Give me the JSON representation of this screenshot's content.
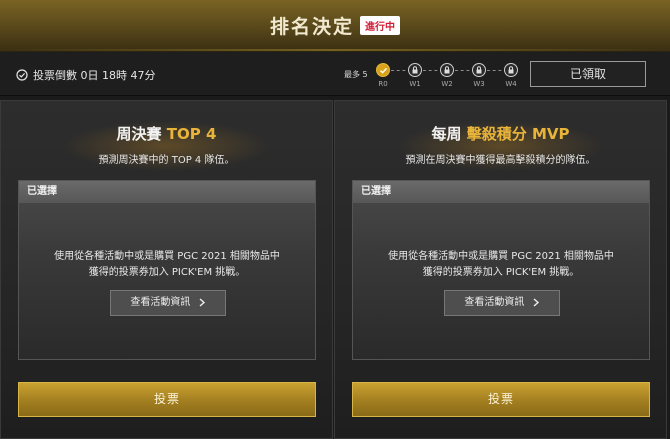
{
  "header": {
    "title": "排名決定",
    "status_badge": "進行中"
  },
  "topbar": {
    "countdown": "投票倒數 0日 18時 47分",
    "max_label": "最多 5",
    "steps": [
      {
        "label": "R0",
        "state": "done"
      },
      {
        "label": "W1",
        "state": "locked"
      },
      {
        "label": "W2",
        "state": "locked"
      },
      {
        "label": "W3",
        "state": "locked"
      },
      {
        "label": "W4",
        "state": "locked"
      }
    ],
    "claimed_button": "已領取"
  },
  "panels": [
    {
      "title_prefix": "周決賽",
      "title_highlight": "TOP 4",
      "description": "預測周決賽中的 TOP 4 隊伍。",
      "chosen_header": "已選擇",
      "body_line1": "使用從各種活動中或是購買 PGC 2021 相關物品中",
      "body_line2": "獲得的投票券加入 PICK'EM 挑戰。",
      "info_button": "查看活動資訊",
      "vote_button": "投票"
    },
    {
      "title_prefix": "每周",
      "title_highlight": "擊殺積分 MVP",
      "description": "預測在周決賽中獲得最高擊殺積分的隊伍。",
      "chosen_header": "已選擇",
      "body_line1": "使用從各種活動中或是購買 PGC 2021 相關物品中",
      "body_line2": "獲得的投票券加入 PICK'EM 挑戰。",
      "info_button": "查看活動資訊",
      "vote_button": "投票"
    }
  ],
  "colors": {
    "accent_gold": "#e9b43a",
    "badge_red": "#d21c35",
    "vote_gold": "#a58121"
  },
  "icons": {
    "countdown": "check-circle-icon",
    "step_done": "check-icon",
    "step_locked": "lock-icon",
    "info_arrow": "chevron-right-icon"
  }
}
